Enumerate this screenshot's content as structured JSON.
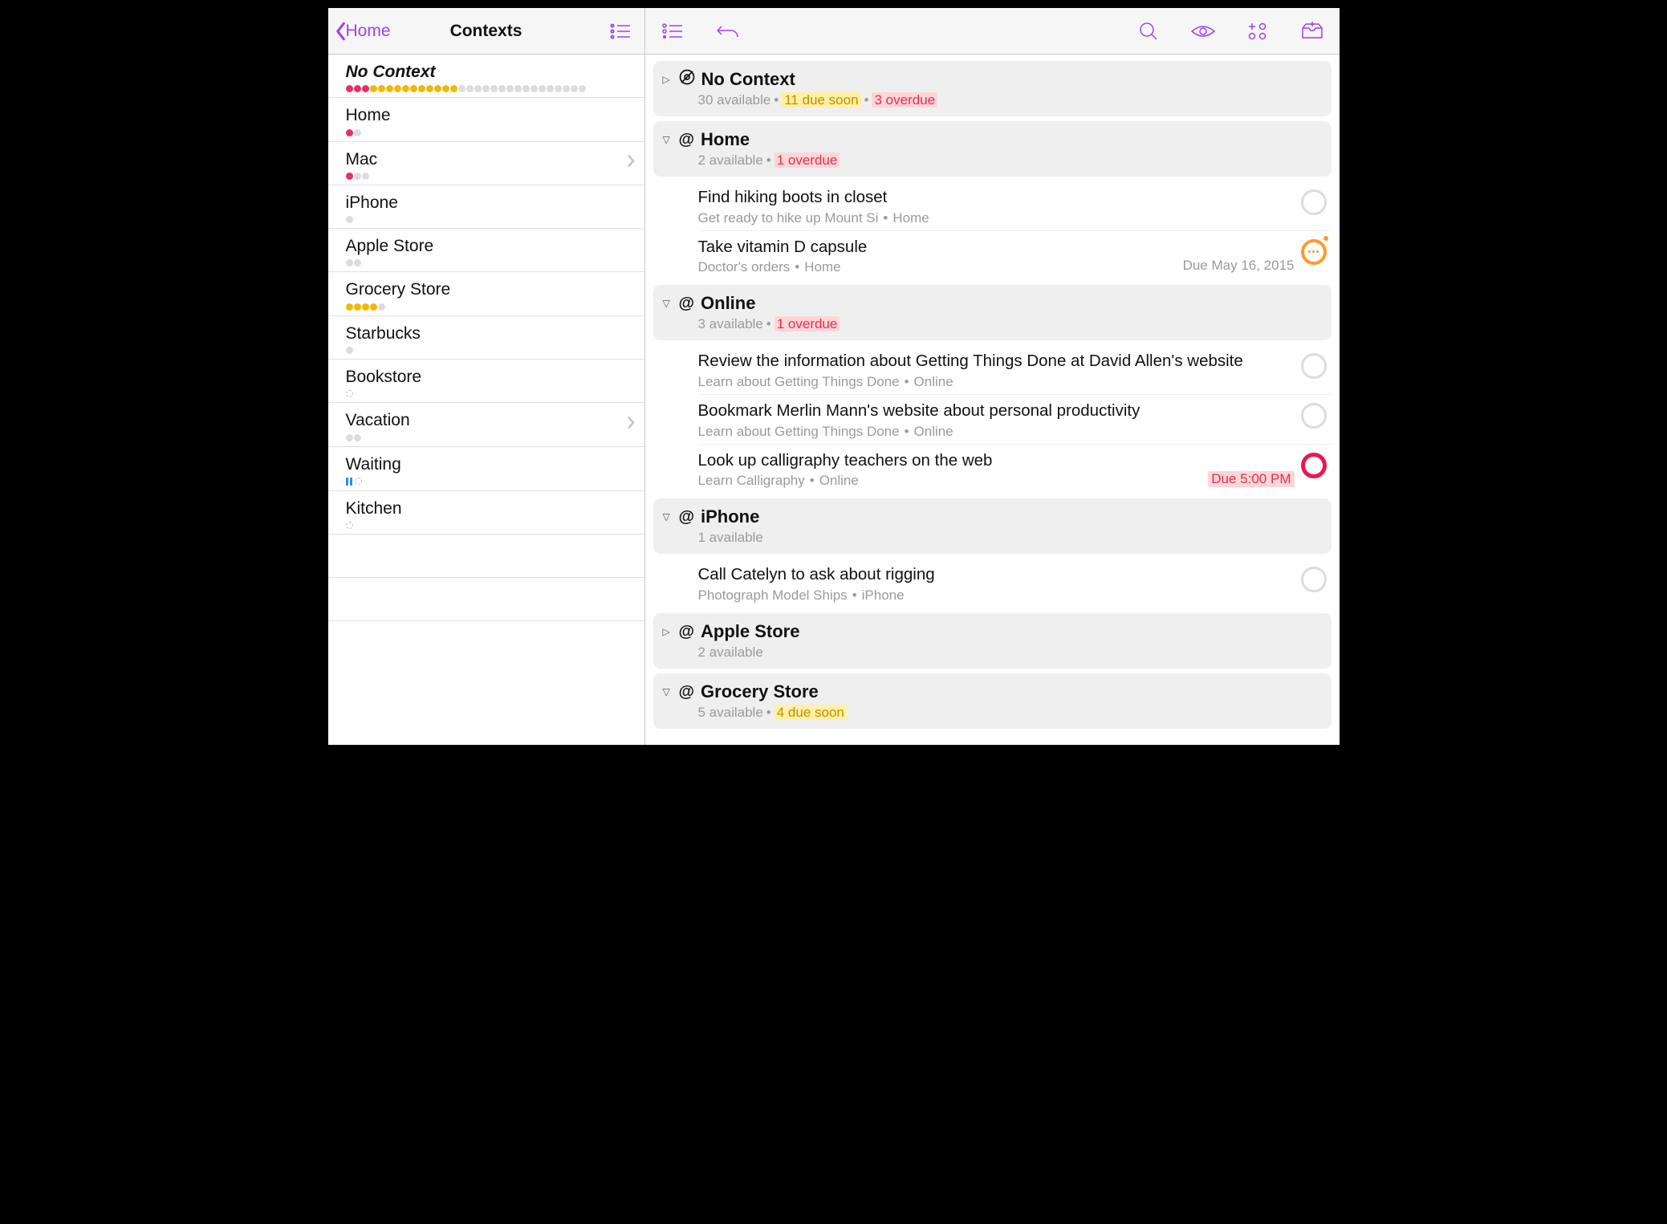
{
  "toolbar": {
    "back_label": "Home",
    "title": "Contexts"
  },
  "sidebar": [
    {
      "name": "No Context",
      "italic": true,
      "chevron": false,
      "dots": [
        "red",
        "red",
        "red",
        "amber",
        "amber",
        "amber",
        "amber",
        "amber",
        "amber",
        "amber",
        "amber",
        "amber",
        "amber",
        "amber",
        "gray",
        "gray",
        "gray",
        "gray",
        "gray",
        "gray",
        "gray",
        "gray",
        "gray",
        "gray",
        "gray",
        "gray",
        "gray",
        "gray",
        "gray",
        "gray"
      ]
    },
    {
      "name": "Home",
      "dots": [
        "red",
        "gray"
      ]
    },
    {
      "name": "Mac",
      "chevron": true,
      "dots": [
        "red",
        "gray",
        "gray"
      ]
    },
    {
      "name": "iPhone",
      "dots": [
        "gray"
      ]
    },
    {
      "name": "Apple Store",
      "dots": [
        "gray",
        "gray"
      ]
    },
    {
      "name": "Grocery Store",
      "dots": [
        "amber",
        "amber",
        "amber",
        "amber",
        "gray"
      ]
    },
    {
      "name": "Starbucks",
      "dots": [
        "gray"
      ]
    },
    {
      "name": "Bookstore",
      "dots": [
        "open"
      ]
    },
    {
      "name": "Vacation",
      "chevron": true,
      "dots": [
        "gray",
        "gray"
      ]
    },
    {
      "name": "Waiting",
      "dots": [
        "pause",
        "open"
      ]
    },
    {
      "name": "Kitchen",
      "dots": [
        "open"
      ]
    }
  ],
  "groups": [
    {
      "expanded": false,
      "icon": "none",
      "title": "No Context",
      "summary": {
        "available": "30 available",
        "soon": "11 due soon",
        "over": "3 overdue"
      },
      "tasks": []
    },
    {
      "expanded": true,
      "icon": "at",
      "title": "Home",
      "summary": {
        "available": "2 available",
        "over": "1 overdue"
      },
      "tasks": [
        {
          "title": "Find hiking boots in closet",
          "project": "Get ready to hike up Mount Si",
          "context": "Home",
          "status": "blank"
        },
        {
          "title": "Take vitamin D capsule",
          "project": "Doctor's orders",
          "context": "Home",
          "due": "Due May 16, 2015",
          "status": "repeat"
        }
      ]
    },
    {
      "expanded": true,
      "icon": "at",
      "title": "Online",
      "summary": {
        "available": "3 available",
        "over": "1 overdue"
      },
      "tasks": [
        {
          "title": "Review the information about Getting Things Done at David Allen's website",
          "project": "Learn about Getting Things Done",
          "context": "Online",
          "status": "blank"
        },
        {
          "title": "Bookmark Merlin Mann's website about personal productivity",
          "project": "Learn about Getting Things Done",
          "context": "Online",
          "status": "blank"
        },
        {
          "title": "Look up calligraphy teachers on the web",
          "project": "Learn Calligraphy",
          "context": "Online",
          "due": "Due 5:00 PM",
          "due_overdue": true,
          "status": "overdue"
        }
      ]
    },
    {
      "expanded": true,
      "icon": "at",
      "title": "iPhone",
      "summary": {
        "available": "1 available"
      },
      "tasks": [
        {
          "title": "Call Catelyn to ask about rigging",
          "project": "Photograph Model Ships",
          "context": "iPhone",
          "status": "blank"
        }
      ]
    },
    {
      "expanded": false,
      "icon": "at",
      "title": "Apple Store",
      "summary": {
        "available": "2 available"
      },
      "tasks": []
    },
    {
      "expanded": true,
      "icon": "at",
      "title": "Grocery Store",
      "summary": {
        "available": "5 available",
        "soon": "4 due soon"
      },
      "tasks": []
    }
  ]
}
